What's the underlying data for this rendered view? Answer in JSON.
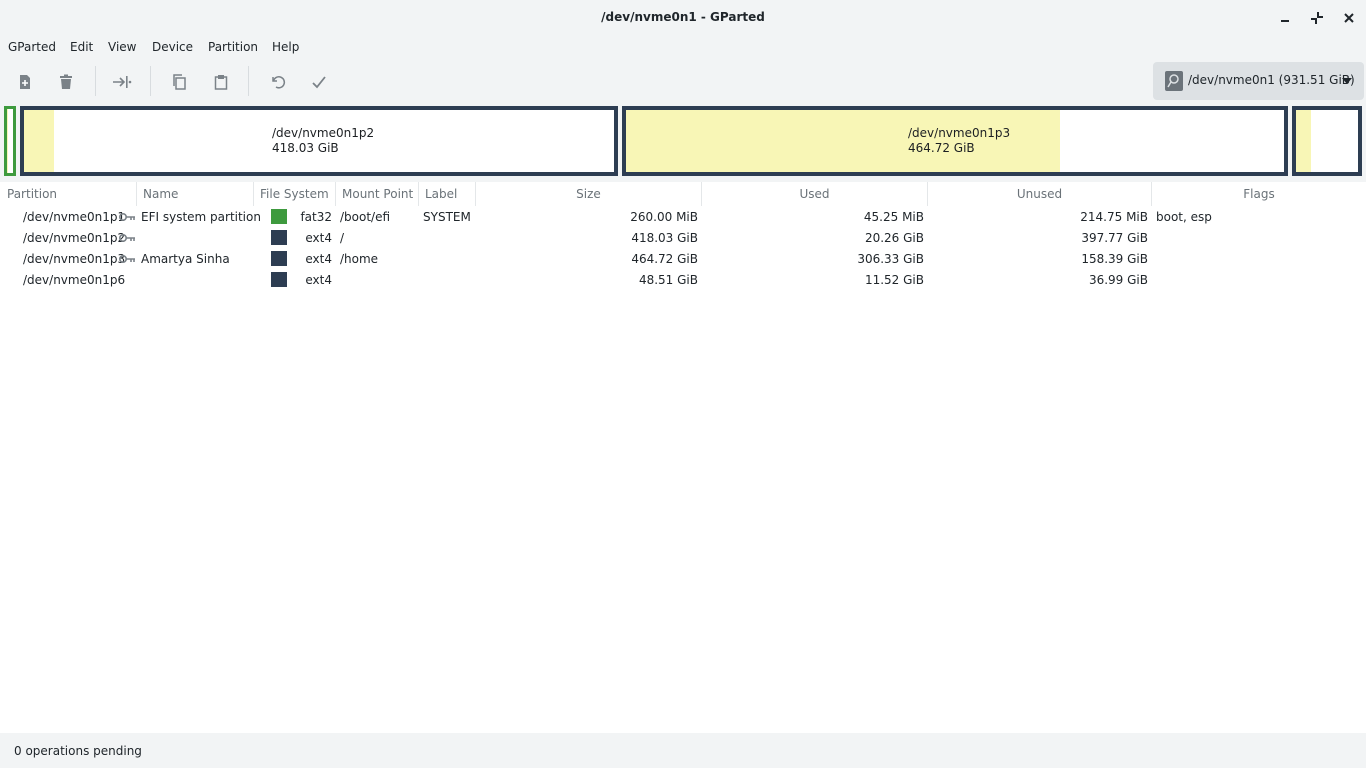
{
  "window": {
    "title": "/dev/nvme0n1 - GParted"
  },
  "menubar": {
    "items": [
      "GParted",
      "Edit",
      "View",
      "Device",
      "Partition",
      "Help"
    ]
  },
  "toolbar": {
    "buttons": [
      "new-partition",
      "delete-partition",
      "resize-move",
      "copy",
      "paste",
      "undo",
      "apply"
    ]
  },
  "device": {
    "selected": "/dev/nvme0n1 (931.51 GiB)"
  },
  "disk_map": {
    "partitions": [
      {
        "name": "",
        "size": "",
        "used_fraction": 0.17
      },
      {
        "name": "/dev/nvme0n1p2",
        "size": "418.03 GiB",
        "used_fraction": 0.05
      },
      {
        "name": "/dev/nvme0n1p3",
        "size": "464.72 GiB",
        "used_fraction": 0.66
      },
      {
        "name": "",
        "size": "",
        "used_fraction": 0.24
      }
    ],
    "colors": {
      "border": "#2d3d52",
      "fat32_border": "#3e9a3e",
      "used": "#f8f6b6",
      "unused": "#ffffff"
    }
  },
  "table": {
    "headers": [
      "Partition",
      "Name",
      "File System",
      "Mount Point",
      "Label",
      "Size",
      "Used",
      "Unused",
      "Flags"
    ],
    "rows": [
      {
        "partition": "/dev/nvme0n1p1",
        "locked": true,
        "name": "EFI system partition",
        "fs": "fat32",
        "fs_color": "#3e9a3e",
        "mount": "/boot/efi",
        "label": "SYSTEM",
        "size": "260.00 MiB",
        "used": "45.25 MiB",
        "unused": "214.75 MiB",
        "flags": "boot, esp"
      },
      {
        "partition": "/dev/nvme0n1p2",
        "locked": true,
        "name": "",
        "fs": "ext4",
        "fs_color": "#2d3d52",
        "mount": "/",
        "label": "",
        "size": "418.03 GiB",
        "used": "20.26 GiB",
        "unused": "397.77 GiB",
        "flags": ""
      },
      {
        "partition": "/dev/nvme0n1p3",
        "locked": true,
        "name": "Amartya Sinha",
        "fs": "ext4",
        "fs_color": "#2d3d52",
        "mount": "/home",
        "label": "",
        "size": "464.72 GiB",
        "used": "306.33 GiB",
        "unused": "158.39 GiB",
        "flags": ""
      },
      {
        "partition": "/dev/nvme0n1p6",
        "locked": false,
        "name": "",
        "fs": "ext4",
        "fs_color": "#2d3d52",
        "mount": "",
        "label": "",
        "size": "48.51 GiB",
        "used": "11.52 GiB",
        "unused": "36.99 GiB",
        "flags": ""
      }
    ]
  },
  "status": {
    "text": "0 operations pending"
  }
}
